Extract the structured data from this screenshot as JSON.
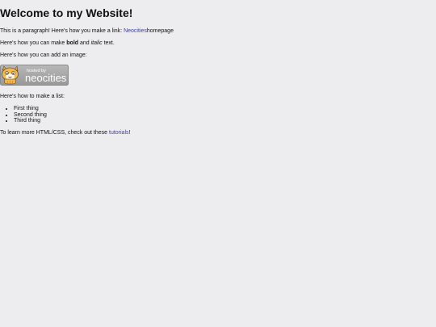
{
  "heading": "Welcome to my Website!",
  "paragraph1": {
    "before": "This is a paragraph! Here's how you make a link: ",
    "link": "Neocities",
    "after": "homepage"
  },
  "paragraph2": {
    "before": "Here's how you can make ",
    "bold": "bold",
    "middle": " and ",
    "italic": "italic",
    "after": " text."
  },
  "paragraph3": "Here's how you can add an image:",
  "badge": {
    "small_text": "hosted by",
    "big_text": "neocities",
    "icon": "neocities-cat-icon",
    "colors": {
      "background": "#a8a8a8",
      "text": "#ffffff",
      "cat": "#f0a43a"
    }
  },
  "paragraph4": "Here's how to make a list:",
  "list": [
    "First thing",
    "Second thing",
    "Third thing"
  ],
  "paragraph5": {
    "before": "To learn more HTML/CSS, check out these ",
    "link": "tutorials",
    "after": "!"
  }
}
